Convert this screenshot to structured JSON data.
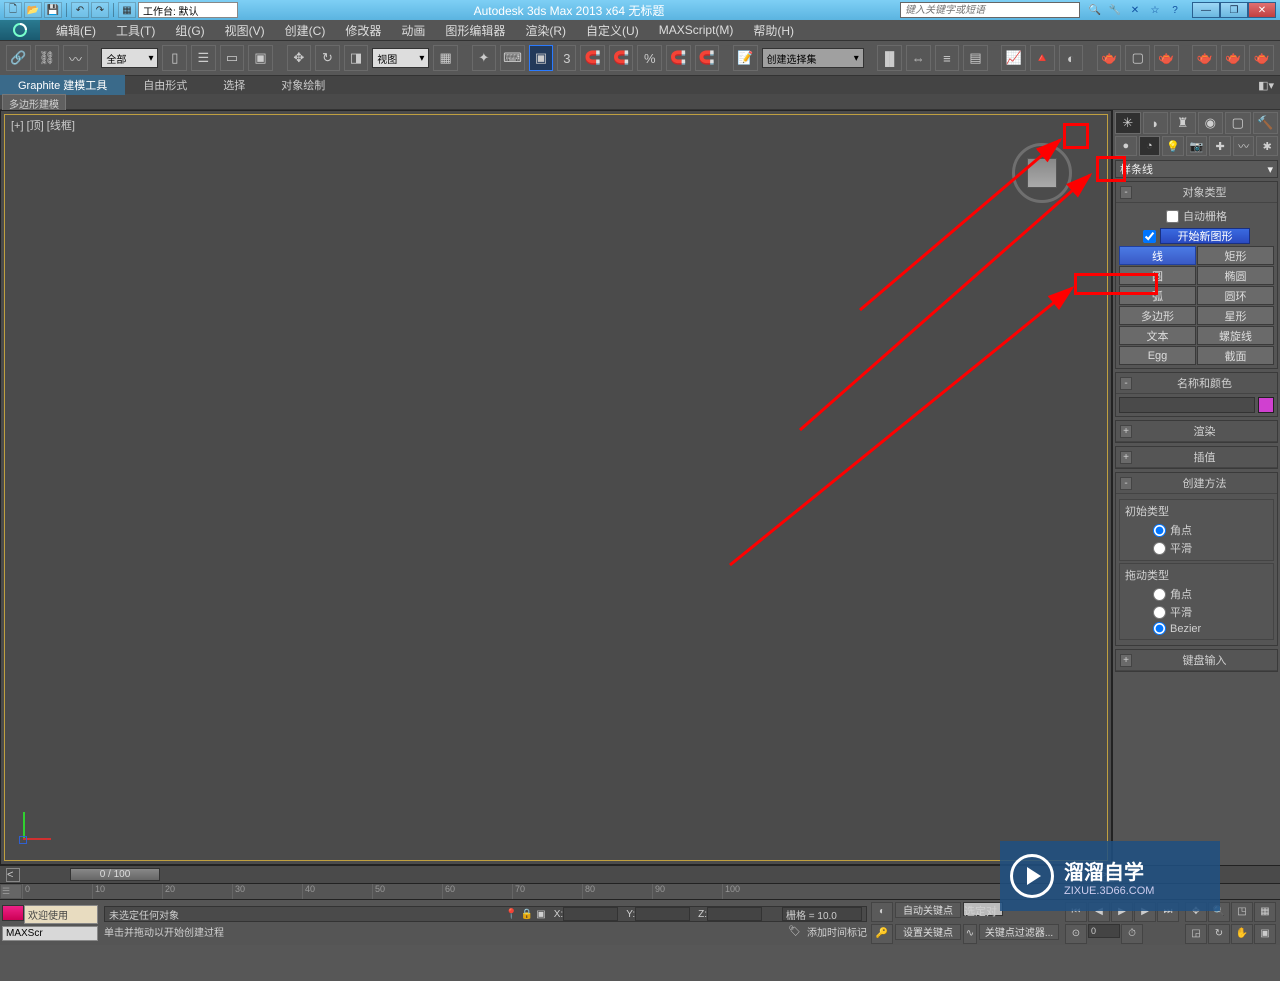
{
  "titlebar": {
    "workspace_label": "工作台: 默认",
    "app_title": "Autodesk 3ds Max  2013 x64   无标题",
    "search_placeholder": "键入关键字或短语"
  },
  "menus": [
    "编辑(E)",
    "工具(T)",
    "组(G)",
    "视图(V)",
    "创建(C)",
    "修改器",
    "动画",
    "图形编辑器",
    "渲染(R)",
    "自定义(U)",
    "MAXScript(M)",
    "帮助(H)"
  ],
  "toolbar": {
    "filter_dd": "全部",
    "view_dd": "视图",
    "namedset_dd": "创建选择集"
  },
  "ribbon": {
    "tabs": [
      "Graphite 建模工具",
      "自由形式",
      "选择",
      "对象绘制"
    ],
    "active": 0,
    "subtab": "多边形建模"
  },
  "viewport": {
    "label": "[+] [顶] [线框]"
  },
  "command_panel": {
    "category_dd": "样条线",
    "rollouts": {
      "object_type": {
        "title": "对象类型",
        "auto_grid": "自动栅格",
        "new_shape": "开始新图形",
        "buttons": [
          "线",
          "矩形",
          "圆",
          "椭圆",
          "弧",
          "圆环",
          "多边形",
          "星形",
          "文本",
          "螺旋线",
          "Egg",
          "截面"
        ],
        "selected_idx": 0
      },
      "name_color": {
        "title": "名称和颜色"
      },
      "render": {
        "title": "渲染"
      },
      "interp": {
        "title": "插值"
      },
      "creation_method": {
        "title": "创建方法",
        "grp1_title": "初始类型",
        "grp1_opts": [
          "角点",
          "平滑"
        ],
        "grp1_sel": 0,
        "grp2_title": "拖动类型",
        "grp2_opts": [
          "角点",
          "平滑",
          "Bezier"
        ],
        "grp2_sel": 2
      },
      "keyboard": {
        "title": "键盘输入"
      }
    }
  },
  "timeline": {
    "slider_label": "0 / 100",
    "ticks": [
      "0",
      "10",
      "20",
      "30",
      "40",
      "50",
      "60",
      "70",
      "80",
      "90",
      "100"
    ]
  },
  "status": {
    "welcome": "欢迎使用",
    "script_label": "MAXScr",
    "sel_none": "未选定任何对象",
    "prompt": "单击并拖动以开始创建过程",
    "x_label": "X:",
    "y_label": "Y:",
    "z_label": "Z:",
    "grid_label": "栅格 = 10.0",
    "add_time_tag": "添加时间标记",
    "autokey": "自动关键点",
    "setkey": "设置关键点",
    "sel_dd": "选定对",
    "keyfilter": "关键点过滤器...",
    "frame": "0"
  },
  "watermark": {
    "main": "溜溜自学",
    "sub": "ZIXUE.3D66.COM"
  }
}
